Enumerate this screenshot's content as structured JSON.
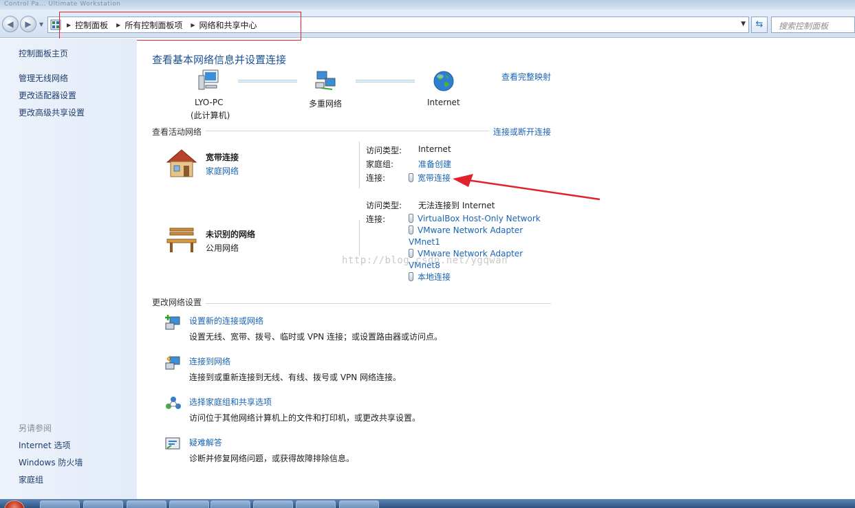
{
  "window": {
    "title_ghost": "Control Pa... Ultimate Workstation"
  },
  "nav": {
    "back_icon": "back-arrow-icon",
    "forward_icon": "forward-arrow-icon",
    "breadcrumb": [
      "控制面板",
      "所有控制面板项",
      "网络和共享中心"
    ],
    "search_placeholder": "搜索控制面板"
  },
  "sidebar": {
    "home": "控制面板主页",
    "items": [
      "管理无线网络",
      "更改适配器设置",
      "更改高级共享设置"
    ],
    "see_also_title": "另请参阅",
    "see_also": [
      "Internet 选项",
      "Windows 防火墙",
      "家庭组"
    ]
  },
  "main": {
    "heading": "查看基本网络信息并设置连接",
    "full_map_link": "查看完整映射",
    "map": {
      "computer_name": "LYO-PC",
      "computer_sub": "(此计算机)",
      "middle": "多重网络",
      "internet": "Internet"
    },
    "active_title": "查看活动网络",
    "connect_link": "连接或断开连接",
    "networks": [
      {
        "name": "宽带连接",
        "type": "家庭网络",
        "access_label": "访问类型:",
        "access_value": "Internet",
        "homegroup_label": "家庭组:",
        "homegroup_value": "准备创建",
        "conn_label": "连接:",
        "connections": [
          "宽带连接"
        ]
      },
      {
        "name": "未识别的网络",
        "type": "公用网络",
        "access_label": "访问类型:",
        "access_value": "无法连接到 Internet",
        "conn_label": "连接:",
        "connections": [
          "VirtualBox Host-Only Network",
          "VMware Network Adapter VMnet1",
          "VMware Network Adapter VMnet8",
          "本地连接"
        ]
      }
    ],
    "change_title": "更改网络设置",
    "tasks": [
      {
        "title": "设置新的连接或网络",
        "desc": "设置无线、宽带、拨号、临时或 VPN 连接；或设置路由器或访问点。",
        "icon": "new-connection-icon"
      },
      {
        "title": "连接到网络",
        "desc": "连接到或重新连接到无线、有线、拨号或 VPN 网络连接。",
        "icon": "connect-network-icon"
      },
      {
        "title": "选择家庭组和共享选项",
        "desc": "访问位于其他网络计算机上的文件和打印机，或更改共享设置。",
        "icon": "homegroup-icon"
      },
      {
        "title": "疑难解答",
        "desc": "诊断并修复网络问题，或获得故障排除信息。",
        "icon": "troubleshoot-icon"
      }
    ]
  },
  "watermark": "http://blog.csdn.net/ygqwan",
  "colors": {
    "link": "#1a64b5",
    "heading": "#1b5296",
    "annotation": "#e0232b"
  }
}
